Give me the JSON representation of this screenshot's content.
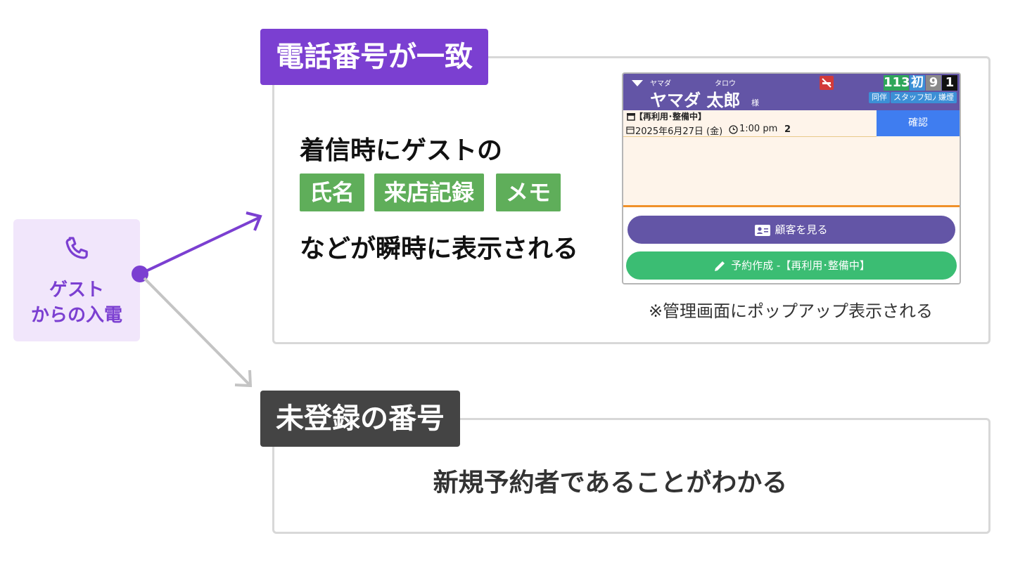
{
  "guest": {
    "line1": "ゲスト",
    "line2": "からの入電",
    "icon": "phone-icon"
  },
  "match": {
    "tag": "電話番号が一致",
    "line1": "着信時にゲストの",
    "chips": [
      "氏名",
      "来店記録",
      "メモ"
    ],
    "line2": "などが瞬時に表示される",
    "note": "※管理画面にポップアップ表示される"
  },
  "popup": {
    "furigana_last": "ヤマダ",
    "furigana_first": "タロウ",
    "name": "ヤマダ 太郎",
    "honorific": "様",
    "badges": [
      "113",
      "初",
      "9",
      "1"
    ],
    "tags": [
      "同伴",
      "スタッフ知人",
      "嫌煙"
    ],
    "status": "【再利用･整備中】",
    "date": "2025年6月27日 (金)",
    "time": "1:00 pm",
    "count": "2",
    "confirm": "確認",
    "view_customer": "顧客を見る",
    "create_reservation": "予約作成 -【再利用･整備中】"
  },
  "unregistered": {
    "tag": "未登録の番号",
    "text": "新規予約者であることがわかる"
  },
  "colors": {
    "purple": "#7b3fd1",
    "green": "#5fae5a",
    "dark": "#444444",
    "popup_header": "#6355a6",
    "confirm_blue": "#3f7df0",
    "action_green": "#3bbd73"
  }
}
